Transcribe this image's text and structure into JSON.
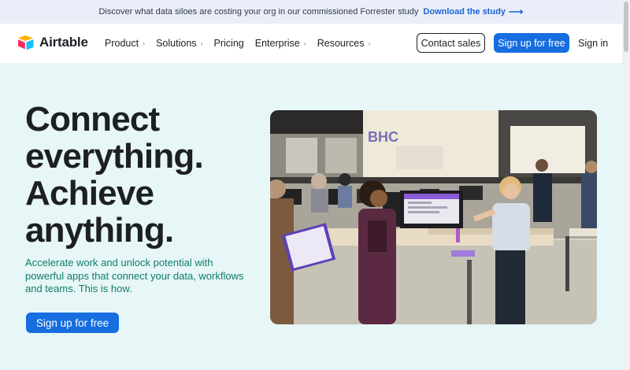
{
  "banner": {
    "text": "Discover what data siloes are costing your org in our commissioned Forrester study",
    "link_label": "Download the study",
    "link_icon": "arrow-right-icon"
  },
  "nav": {
    "logo_text": "Airtable",
    "items": [
      {
        "label": "Product",
        "has_menu": true
      },
      {
        "label": "Solutions",
        "has_menu": true
      },
      {
        "label": "Pricing",
        "has_menu": false
      },
      {
        "label": "Enterprise",
        "has_menu": true
      },
      {
        "label": "Resources",
        "has_menu": true
      }
    ],
    "contact_label": "Contact sales",
    "signup_label": "Sign up for free",
    "signin_label": "Sign in"
  },
  "hero": {
    "headline_lines": [
      "Connect",
      "everything.",
      "Achieve",
      "anything."
    ],
    "subtext": "Accelerate work and unlock potential with powerful apps that connect your data, workflows and teams. This is how.",
    "cta_label": "Sign up for free",
    "image_alt": "Office photo of colleagues collaborating around desks and monitors"
  },
  "colors": {
    "accent": "#166ee1",
    "hero_background": "#e7f6f6",
    "banner_background": "#e9eef9",
    "subtext": "#0d7d6c"
  }
}
